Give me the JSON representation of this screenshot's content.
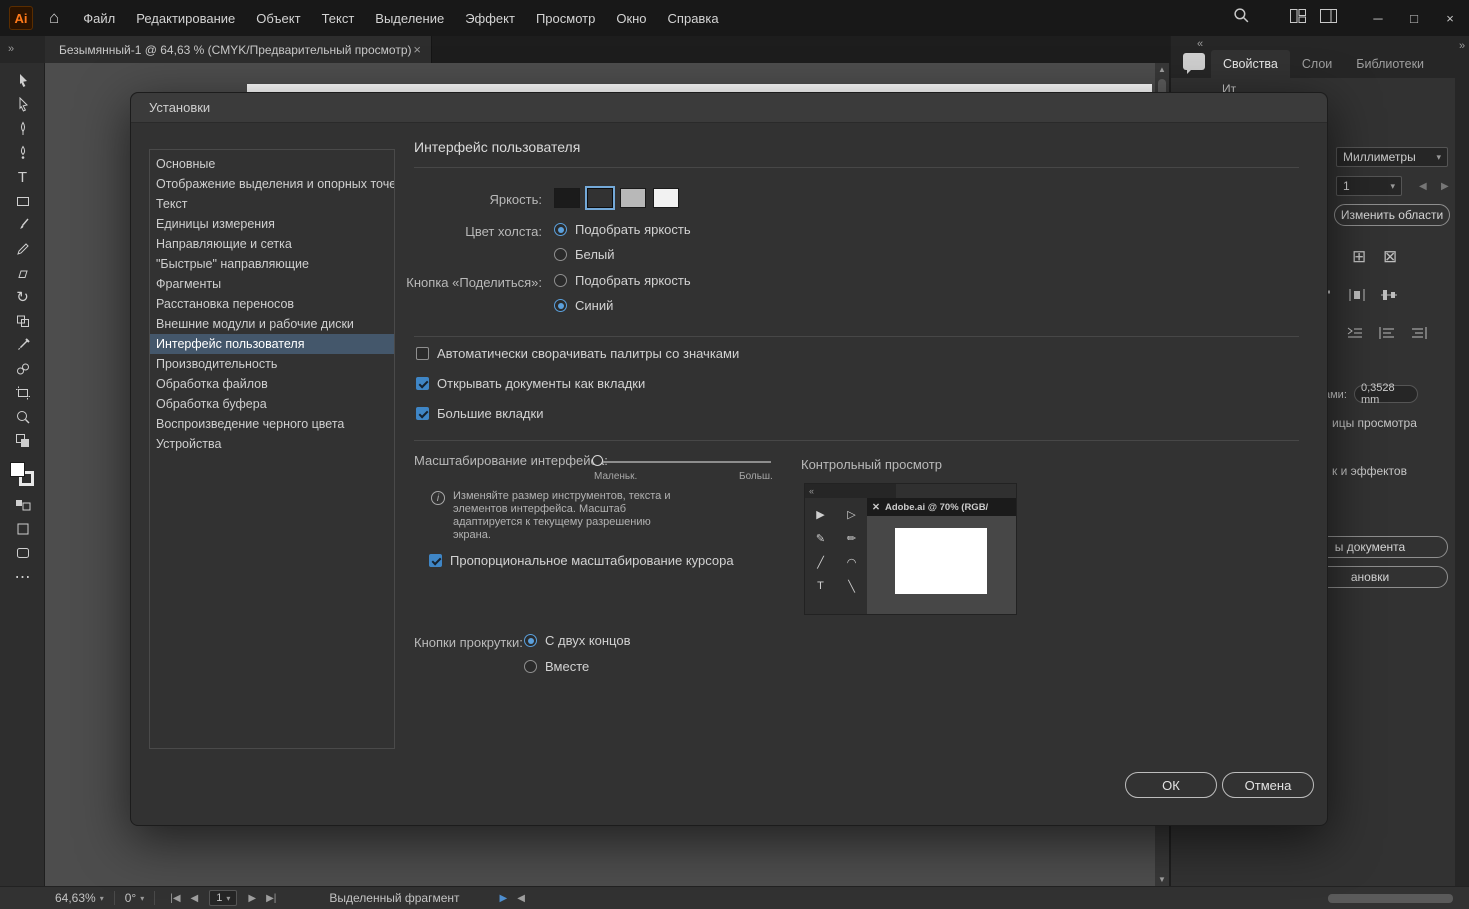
{
  "colors": {
    "accent_blue": "#3f86c6",
    "selection_bg": "#44576b",
    "dialog_bg": "#323232"
  },
  "icons": {
    "home": "⌂",
    "chevrons_right": "»",
    "chevrons_left": "«",
    "dropdown": "▾",
    "up": "▲",
    "down": "▼",
    "left": "◀",
    "right": "▶",
    "first": "|◀",
    "last": "▶|",
    "minimize": "─",
    "maximize": "□",
    "close": "×",
    "ellipsis": "⋯",
    "rotate_tool": "↻",
    "type_tool": "T",
    "grid": "⊞",
    "grid_x": "⊠",
    "preview_tools": [
      "▶",
      "▷",
      "✎",
      "✏",
      "╱",
      "◠",
      "T",
      "╲"
    ]
  },
  "menu_bar": {
    "logo": "Ai",
    "items": [
      "Файл",
      "Редактирование",
      "Объект",
      "Текст",
      "Выделение",
      "Эффект",
      "Просмотр",
      "Окно",
      "Справка"
    ]
  },
  "window_controls": {
    "minimize": "─",
    "maximize": "□",
    "close": "×"
  },
  "doc_tab": {
    "title": "Безымянный-1 @ 64,63 % (CMYK/Предварительный просмотр)",
    "close": "×"
  },
  "panel_header": {
    "tabs": [
      {
        "label": "Свойства",
        "active": true
      },
      {
        "label": "Слои",
        "active": false
      },
      {
        "label": "Библиотеки",
        "active": false
      }
    ],
    "fragment": "Ит"
  },
  "right_panel": {
    "units_value": "Миллиметры",
    "count_value": "1",
    "edit_artboards": "Изменить области",
    "stroke_label_fragment": "ами:",
    "stroke_value": "0,3528 mm",
    "view_units_fragment": "ицы просмотра",
    "effects_fragment": "к и эффектов",
    "doc_setup_fragment": "ы документа",
    "preferences_fragment": "ановки"
  },
  "tools": [
    "selection-tool",
    "direct-selection-tool",
    "pen-tool",
    "curvature-tool",
    "type-tool",
    "rectangle-tool",
    "paintbrush-tool",
    "pencil-tool",
    "eraser-tool",
    "rotate-tool",
    "shape-builder-tool",
    "eyedropper-tool",
    "blend-tool",
    "artboard-tool",
    "zoom-tool",
    "edit-toolbar"
  ],
  "dialog": {
    "title": "Установки",
    "sidebar": [
      {
        "label": "Основные",
        "selected": false
      },
      {
        "label": "Отображение выделения и опорных точек",
        "selected": false
      },
      {
        "label": "Текст",
        "selected": false
      },
      {
        "label": "Единицы измерения",
        "selected": false
      },
      {
        "label": "Направляющие и сетка",
        "selected": false
      },
      {
        "label": "\"Быстрые\" направляющие",
        "selected": false
      },
      {
        "label": "Фрагменты",
        "selected": false
      },
      {
        "label": "Расстановка переносов",
        "selected": false
      },
      {
        "label": "Внешние модули и рабочие диски",
        "selected": false
      },
      {
        "label": "Интерфейс пользователя",
        "selected": true
      },
      {
        "label": "Производительность",
        "selected": false
      },
      {
        "label": "Обработка файлов",
        "selected": false
      },
      {
        "label": "Обработка буфера",
        "selected": false
      },
      {
        "label": "Воспроизведение черного цвета",
        "selected": false
      },
      {
        "label": "Устройства",
        "selected": false
      }
    ],
    "section_title": "Интерфейс пользователя",
    "brightness": {
      "label": "Яркость:",
      "swatches": [
        "#1b1b1b",
        "#323232",
        "#b8b8b8",
        "#f2f2f2"
      ],
      "selected_index": 1
    },
    "canvas_color": {
      "label": "Цвет холста:",
      "options": [
        {
          "label": "Подобрать яркость",
          "selected": true
        },
        {
          "label": "Белый",
          "selected": false
        }
      ]
    },
    "share_button": {
      "label": "Кнопка «Поделиться»:",
      "options": [
        {
          "label": "Подобрать яркость",
          "selected": false
        },
        {
          "label": "Синий",
          "selected": true
        }
      ]
    },
    "checkboxes": [
      {
        "label": "Автоматически сворачивать палитры со значками",
        "checked": false
      },
      {
        "label": "Открывать документы как вкладки",
        "checked": true
      },
      {
        "label": "Большие вкладки",
        "checked": true
      }
    ],
    "ui_scale": {
      "label": "Масштабирование интерфейса:",
      "min": "Маленьк.",
      "max": "Больш."
    },
    "info_text": "Изменяйте размер инструментов, текста и элементов интерфейса. Масштаб адаптируется к текущему разрешению экрана.",
    "cursor_scaling": {
      "label": "Пропорциональное масштабирование курсора",
      "checked": true
    },
    "preview": {
      "label": "Контрольный просмотр",
      "tab_text": "Adobe.ai @ 70% (RGB/",
      "close": "✕"
    },
    "scroll_buttons": {
      "label": "Кнопки прокрутки:",
      "options": [
        {
          "label": "С двух концов",
          "selected": true
        },
        {
          "label": "Вместе",
          "selected": false
        }
      ]
    },
    "ok": "ОК",
    "cancel": "Отмена"
  },
  "status_bar": {
    "zoom": "64,63%",
    "rotation": "0°",
    "page": "1",
    "tool_label": "Выделенный фрагмент"
  }
}
